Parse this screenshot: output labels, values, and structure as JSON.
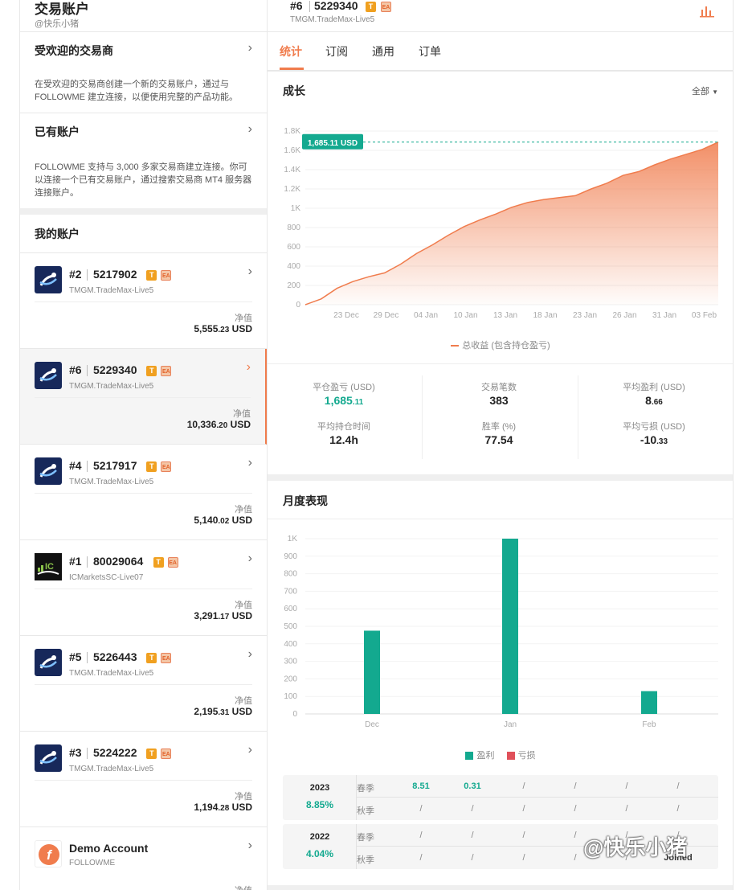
{
  "left": {
    "title": "交易账户",
    "handle": "@快乐小猪",
    "popular": {
      "title": "受欢迎的交易商",
      "desc": "在受欢迎的交易商创建一个新的交易账户，通过与 FOLLOWME 建立连接，以便使用完整的产品功能。"
    },
    "existing": {
      "title": "已有账户",
      "desc": "FOLLOWME 支持与 3,000 多家交易商建立连接。你可以连接一个已有交易账户，通过搜索交易商 MT4 服务器连接账户。"
    },
    "my_accounts": "我的账户",
    "net_label": "净值",
    "accounts": [
      {
        "num": "#2",
        "id": "5217902",
        "server": "TMGM.TradeMax-Live5",
        "value": "5,555",
        "cents": ".23",
        "unit": "USD",
        "logo": "tmgm"
      },
      {
        "num": "#6",
        "id": "5229340",
        "server": "TMGM.TradeMax-Live5",
        "value": "10,336",
        "cents": ".20",
        "unit": "USD",
        "logo": "tmgm",
        "active": true
      },
      {
        "num": "#4",
        "id": "5217917",
        "server": "TMGM.TradeMax-Live5",
        "value": "5,140",
        "cents": ".02",
        "unit": "USD",
        "logo": "tmgm"
      },
      {
        "num": "#1",
        "id": "80029064",
        "server": "ICMarketsSC-Live07",
        "value": "3,291",
        "cents": ".17",
        "unit": "USD",
        "logo": "ic"
      },
      {
        "num": "#5",
        "id": "5226443",
        "server": "TMGM.TradeMax-Live5",
        "value": "2,195",
        "cents": ".31",
        "unit": "USD",
        "logo": "tmgm"
      },
      {
        "num": "#3",
        "id": "5224222",
        "server": "TMGM.TradeMax-Live5",
        "value": "1,194",
        "cents": ".28",
        "unit": "USD",
        "logo": "tmgm"
      }
    ],
    "demo": {
      "name": "Demo Account",
      "sub": "FOLLOWME",
      "net_label": "净值"
    },
    "tag_t": "T",
    "tag_ea": "EA"
  },
  "right": {
    "header": {
      "num": "#6",
      "id": "5229340",
      "server": "TMGM.TradeMax-Live5",
      "tag_t": "T",
      "tag_ea": "EA"
    },
    "tabs": [
      "统计",
      "订阅",
      "通用",
      "订单"
    ],
    "growth": {
      "title": "成长",
      "filter": "全部",
      "marker": "1,685.11 USD",
      "legend": "总收益 (包含持仓盈亏)"
    },
    "stats": [
      {
        "label": "平仓盈亏 (USD)",
        "value": "1,685",
        "small": ".11",
        "color": "#13a98f"
      },
      {
        "label": "交易笔数",
        "value": "383",
        "small": "",
        "color": "#222"
      },
      {
        "label": "平均盈利 (USD)",
        "value": "8",
        "small": ".66",
        "color": "#222"
      },
      {
        "label": "平均持仓时间",
        "value": "12.4h",
        "small": "",
        "color": "#222"
      },
      {
        "label": "胜率 (%)",
        "value": "77.54",
        "small": "",
        "color": "#222"
      },
      {
        "label": "平均亏损 (USD)",
        "value": "-10",
        "small": ".33",
        "color": "#222"
      }
    ],
    "monthly": {
      "title": "月度表现",
      "legend_profit": "盈利",
      "legend_loss": "亏损"
    },
    "table": [
      {
        "year": "2023",
        "pct": "8.85%",
        "rows": [
          {
            "season": "春季",
            "cells": [
              "8.51",
              "0.31",
              "/",
              "/",
              "/",
              "/"
            ]
          },
          {
            "season": "秋季",
            "cells": [
              "/",
              "/",
              "/",
              "/",
              "/",
              "/"
            ]
          }
        ]
      },
      {
        "year": "2022",
        "pct": "4.04%",
        "rows": [
          {
            "season": "春季",
            "cells": [
              "/",
              "/",
              "/",
              "/",
              "/",
              "/"
            ]
          },
          {
            "season": "秋季",
            "cells": [
              "/",
              "/",
              "/",
              "/",
              "/",
              "Joined"
            ]
          }
        ]
      }
    ],
    "watermark": "@快乐小猪"
  },
  "colors": {
    "accent": "#f07c4d",
    "green": "#13a98f",
    "loss": "#e0505a"
  },
  "chart_data": [
    {
      "type": "area",
      "title": "成长",
      "x_ticks": [
        "23 Dec",
        "29 Dec",
        "04 Jan",
        "10 Jan",
        "13 Jan",
        "18 Jan",
        "23 Jan",
        "26 Jan",
        "31 Jan",
        "03 Feb"
      ],
      "y_ticks": [
        "0",
        "200",
        "400",
        "600",
        "800",
        "1K",
        "1.2K",
        "1.4K",
        "1.6K",
        "1.8K"
      ],
      "ylim": [
        0,
        1800
      ],
      "series": [
        {
          "name": "总收益 (包含持仓盈亏)",
          "values": [
            0,
            60,
            170,
            240,
            290,
            330,
            420,
            530,
            620,
            720,
            810,
            880,
            940,
            1010,
            1060,
            1090,
            1110,
            1130,
            1200,
            1260,
            1340,
            1380,
            1450,
            1510,
            1560,
            1610,
            1685
          ]
        }
      ],
      "marker_value": 1685.11
    },
    {
      "type": "bar",
      "title": "月度表现",
      "categories": [
        "Dec",
        "Jan",
        "Feb"
      ],
      "y_ticks": [
        "0",
        "100",
        "200",
        "300",
        "400",
        "500",
        "600",
        "700",
        "800",
        "900",
        "1K"
      ],
      "ylim": [
        0,
        1000
      ],
      "series": [
        {
          "name": "盈利",
          "values": [
            475,
            1000,
            130
          ]
        },
        {
          "name": "亏损",
          "values": [
            0,
            0,
            0
          ]
        }
      ]
    }
  ]
}
